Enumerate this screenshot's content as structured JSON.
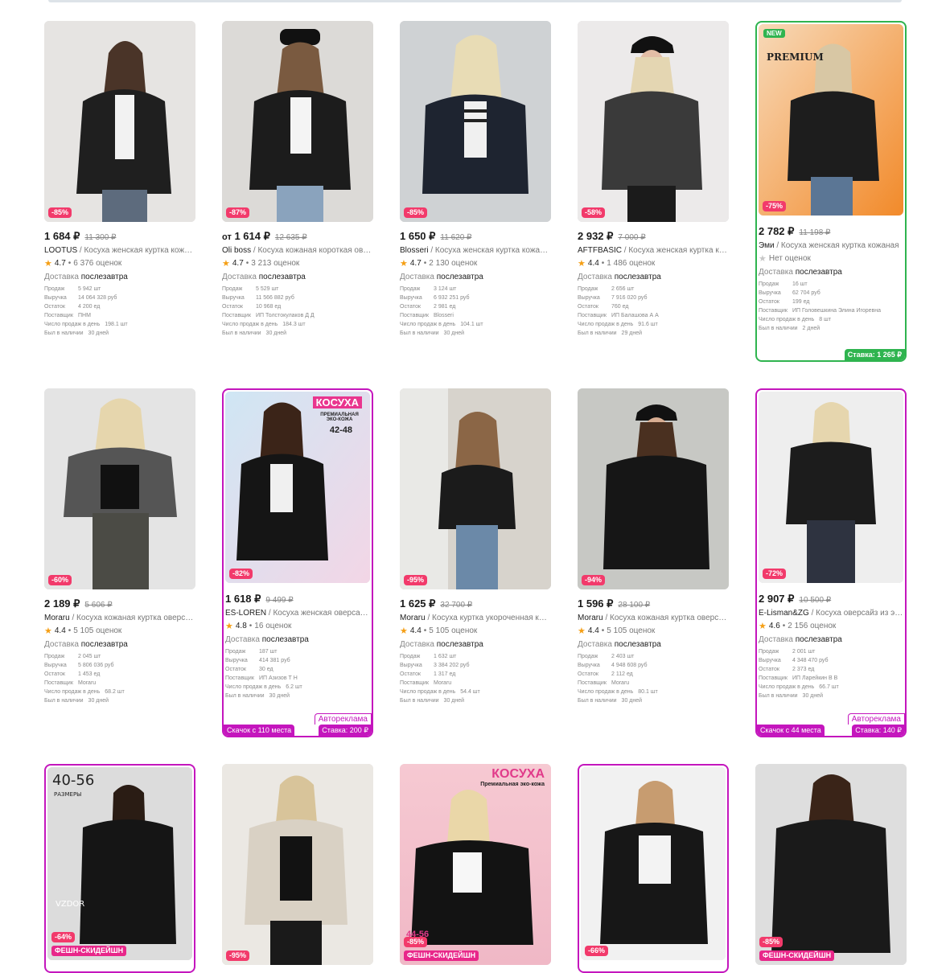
{
  "labels": {
    "delivery_prefix": "Доставка",
    "stat_keys": [
      "Продаж",
      "Выручка",
      "Остаток",
      "Поставщик",
      "Число продаж в день",
      "Был в наличии"
    ]
  },
  "cards": [
    {
      "discount": "-85%",
      "price": "1 684 ₽",
      "old": "11 300 ₽",
      "brand": "LOOTUS",
      "name": " / Косуха женская куртка кожаная",
      "rating": "4.7",
      "reviews": "6 376 оценок",
      "delivery": "послезавтра",
      "stats": [
        "5 942 шт",
        "14 064 328 руб",
        "4 200 ед",
        "ПНМ",
        "198.1 шт",
        "30 дней"
      ],
      "image": "woman-black-leather-jacket-photo"
    },
    {
      "discount": "-87%",
      "price": "1 614 ₽",
      "from": "от",
      "old": "12 635 ₽",
      "brand": "Oli boss",
      "name": " / Косуха кожаная короткая оверсайз",
      "rating": "4.7",
      "reviews": "3 213 оценок",
      "delivery": "послезавтра",
      "stats": [
        "5 529 шт",
        "11 566 882 руб",
        "10 968 ед",
        "ИП Толстокулаков Д Д",
        "184.3 шт",
        "30 дней"
      ],
      "image": "woman-cap-black-jacket-photo"
    },
    {
      "discount": "-85%",
      "price": "1 650 ₽",
      "old": "11 620 ₽",
      "brand": "Blosseri",
      "name": " / Косуха женская куртка кожаная",
      "rating": "4.7",
      "reviews": "2 130 оценок",
      "delivery": "послезавтра",
      "stats": [
        "3 124 шт",
        "6 932 251 руб",
        "2 981 ед",
        "Blosseri",
        "104.1 шт",
        "30 дней"
      ],
      "image": "blonde-woman-black-jacket-photo"
    },
    {
      "discount": "-58%",
      "price": "2 932 ₽",
      "old": "7 000 ₽",
      "brand": "AFTFBASIC",
      "name": " / Косуха женская куртка кожаная",
      "rating": "4.4",
      "reviews": "1 486 оценок",
      "delivery": "послезавтра",
      "stats": [
        "2 656 шт",
        "7 916 020 руб",
        "760 ед",
        "ИП Балашова А А",
        "91.6 шт",
        "29 дней"
      ],
      "image": "woman-cap-grey-jacket-photo"
    },
    {
      "discount": "-75%",
      "price": "2 782 ₽",
      "old": "11 198 ₽",
      "brand": "Эми",
      "name": " / Косуха женская куртка кожаная",
      "rating": "",
      "reviews": "Нет оценок",
      "delivery": "послезавтра",
      "stats": [
        "16 шт",
        "62 704 руб",
        "199 ед",
        "ИП Головешкина Элина Игоревна",
        "8 шт",
        "2 дней"
      ],
      "badge": "NEW",
      "overlay": "PREMIUM",
      "bid": "Ставка: 1 265 ₽",
      "image": "woman-orange-background-photo"
    },
    {
      "discount": "-60%",
      "price": "2 189 ₽",
      "old": "5 606 ₽",
      "brand": "Moraru",
      "name": " / Косуха кожаная куртка оверсайз",
      "rating": "4.4",
      "reviews": "5 105 оценок",
      "delivery": "послезавтра",
      "stats": [
        "2 045 шт",
        "5 806 036 руб",
        "1 453 ед",
        "Moraru",
        "68.2 шт",
        "30 дней"
      ],
      "image": "blonde-grey-jacket-photo"
    },
    {
      "discount": "-82%",
      "price": "1 618 ₽",
      "old": "9 499 ₽",
      "brand": "ES-LOREN",
      "name": " / Косуха женская оверсайз кожаная",
      "rating": "4.8",
      "reviews": "16 оценок",
      "delivery": "послезавтра",
      "stats": [
        "187 шт",
        "414 381 руб",
        "30 ед",
        "ИП Азизов Т Н",
        "6.2 шт",
        "30 дней"
      ],
      "overlay": "КОСУХА",
      "overlay_sub": "ПРЕМИАЛЬНАЯ ЭКО-КОЖА",
      "overlay_size": "42-48",
      "ad": "Автореклама",
      "boost": "Скачок с 110 места",
      "bid": "Ставка: 200 ₽",
      "image": "brunette-black-jacket-photo"
    },
    {
      "discount": "-95%",
      "price": "1 625 ₽",
      "old": "32 700 ₽",
      "brand": "Moraru",
      "name": " / Косуха куртка укороченная кожаная",
      "rating": "4.4",
      "reviews": "5 105 оценок",
      "delivery": "послезавтра",
      "stats": [
        "1 632 шт",
        "3 384 202 руб",
        "1 317 ед",
        "Moraru",
        "54.4 шт",
        "30 дней"
      ],
      "image": "woman-waving-street-photo"
    },
    {
      "discount": "-94%",
      "price": "1 596 ₽",
      "old": "28 100 ₽",
      "brand": "Moraru",
      "name": " / Косуха кожаная куртка оверсайз",
      "rating": "4.4",
      "reviews": "5 105 оценок",
      "delivery": "послезавтра",
      "stats": [
        "2 403 шт",
        "4 948 608 руб",
        "2 112 ед",
        "Moraru",
        "80.1 шт",
        "30 дней"
      ],
      "image": "woman-cap-black-jacket-2-photo"
    },
    {
      "discount": "-72%",
      "price": "2 907 ₽",
      "old": "10 500 ₽",
      "brand": "E-Lisman&ZG",
      "name": " / Косуха оверсайз из экокожи",
      "rating": "4.6",
      "reviews": "2 156 оценок",
      "delivery": "послезавтра",
      "stats": [
        "2 001 шт",
        "4 348 470 руб",
        "2 373 ед",
        "ИП Ларейкин В В",
        "66.7 шт",
        "30 дней"
      ],
      "ad": "Автореклама",
      "boost": "Скачок с 44 места",
      "bid": "Ставка: 140 ₽",
      "image": "blonde-black-jacket-studio-photo"
    },
    {
      "discount": "-64%",
      "fashion": "ФЕШН-СКИДЕЙШН",
      "overlay": "40-56",
      "overlay_sub": "РАЗМЕРЫ",
      "overlay_brand": "VZDOR",
      "image": "woman-sunglasses-black-jacket-photo"
    },
    {
      "discount": "-95%",
      "image": "woman-beige-jacket-photo"
    },
    {
      "discount": "-85%",
      "fashion": "ФЕШН-СКИДЕЙШН",
      "overlay": "КОСУХА",
      "overlay_sub": "Премиальная эко-кожа",
      "overlay_size": "44-56",
      "image": "woman-pink-background-photo"
    },
    {
      "discount": "-66%",
      "image": "woman-black-jacket-studio-photo"
    },
    {
      "discount": "-85%",
      "fashion": "ФЕШН-СКИДЕЙШН",
      "image": "brunette-black-jacket-grey-photo"
    }
  ]
}
